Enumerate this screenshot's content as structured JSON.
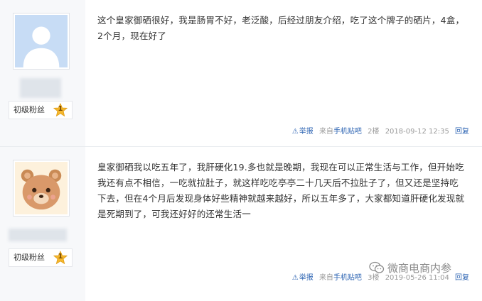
{
  "posts": [
    {
      "fan_label": "初级粉丝",
      "fan_level": "1",
      "content": "这个皇家御硒很好，我是肠胃不好，老泛酸，后经过朋友介绍，吃了这个牌子的硒片，4盒，2个月，现在好了",
      "report_label": "举报",
      "source_prefix": "来自",
      "source_link": "手机贴吧",
      "floor": "2楼",
      "timestamp": "2018-09-12 12:35",
      "reply_label": "回复"
    },
    {
      "fan_label": "初级粉丝",
      "fan_level": "1",
      "content": "皇家御硒我以吃五年了，我肝硬化19.多也就是晚期，我现在可以正常生活与工作，但开始吃我还有点不相信，一吃就拉肚子，就这样吃吃亭亭二十几天后不拉肚子了，但又还是坚持吃下去，但在4个月后发现身体好些精神就越来越好，所以五年多了，大家都知道肝硬化发现就是死期到了，可我还好好的还常生活一",
      "report_label": "举报",
      "source_prefix": "来自",
      "source_link": "手机贴吧",
      "floor": "3楼",
      "timestamp": "2019-05-26 11:04",
      "reply_label": "回复"
    }
  ],
  "watermark": {
    "text": "微商电商内参",
    "icon": "wechat-logo"
  },
  "icons": {
    "report": "warning-triangle-icon",
    "level": "star-badge-icon",
    "avatar_default": "default-user-avatar",
    "avatar_bear": "bear-avatar"
  },
  "colors": {
    "link": "#2d64b3",
    "sidebar": "#f7f8fa",
    "badge_star": "#f5b82e",
    "meta_text": "#999999"
  }
}
